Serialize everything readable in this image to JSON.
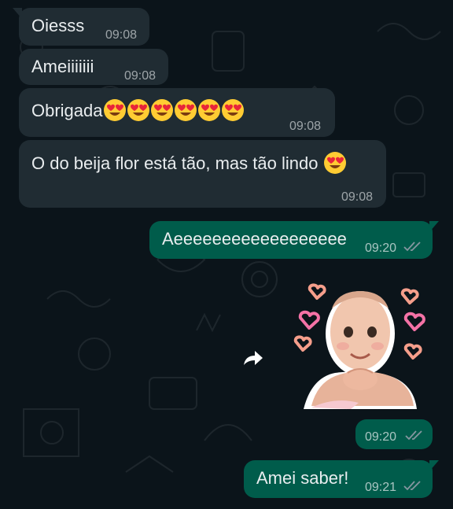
{
  "conversation": {
    "messages": [
      {
        "direction": "in",
        "text": "Oiesss",
        "time": "09:08"
      },
      {
        "direction": "in",
        "text": "Ameiiiiiii",
        "time": "09:08"
      },
      {
        "direction": "in",
        "text": "Obrigada",
        "emoji_count": 6,
        "emoji": "heart-eyes-emoji",
        "time": "09:08"
      },
      {
        "direction": "in",
        "text": "O do beija flor está tão, mas tão lindo",
        "emoji_count": 1,
        "emoji": "heart-eyes-emoji",
        "time": "09:08"
      },
      {
        "direction": "out",
        "text": "Aeeeeeeeeeeeeeeeeee",
        "time": "09:20",
        "status": "read"
      },
      {
        "direction": "out",
        "type": "sticker",
        "sticker": "baby-with-hearts-sticker",
        "time": "09:20",
        "status": "read"
      },
      {
        "direction": "out",
        "text": "Amei saber!",
        "time": "09:21",
        "status": "read"
      }
    ]
  },
  "icons": {
    "forward": "forward-arrow-icon",
    "read_receipt": "double-check-icon"
  },
  "colors": {
    "background": "#0b141a",
    "incoming_bubble": "#202c33",
    "outgoing_bubble": "#005c4b",
    "text": "#e9edef",
    "read_ticks": "#8696a0"
  }
}
